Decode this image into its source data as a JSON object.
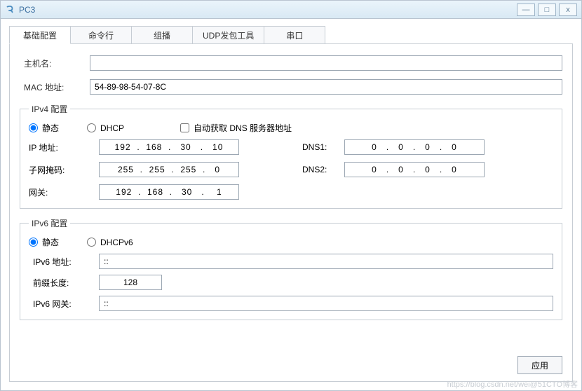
{
  "window": {
    "title": "PC3"
  },
  "tabs": {
    "items": [
      "基础配置",
      "命令行",
      "组播",
      "UDP发包工具",
      "串口"
    ],
    "active": 0
  },
  "basic": {
    "hostname_label": "主机名:",
    "hostname_value": "",
    "mac_label": "MAC 地址:",
    "mac_value": "54-89-98-54-07-8C"
  },
  "ipv4": {
    "legend": "IPv4 配置",
    "radio_static": "静态",
    "radio_dhcp": "DHCP",
    "auto_dns_label": "自动获取 DNS 服务器地址",
    "ip_label": "IP 地址:",
    "ip_value": "192  .  168  .   30   .   10",
    "mask_label": "子网掩码:",
    "mask_value": "255  .  255  .  255  .   0",
    "gw_label": "网关:",
    "gw_value": "192  .  168  .   30   .    1",
    "dns1_label": "DNS1:",
    "dns1_value": "0   .   0   .   0   .   0",
    "dns2_label": "DNS2:",
    "dns2_value": "0   .   0   .   0   .   0"
  },
  "ipv6": {
    "legend": "IPv6 配置",
    "radio_static": "静态",
    "radio_dhcpv6": "DHCPv6",
    "addr_label": "IPv6 地址:",
    "addr_value": "::",
    "prefix_label": "前缀长度:",
    "prefix_value": "128",
    "gw_label": "IPv6 网关:",
    "gw_value": "::"
  },
  "footer": {
    "apply": "应用"
  },
  "watermark": "https://blog.csdn.net/wei@51CTO博客"
}
